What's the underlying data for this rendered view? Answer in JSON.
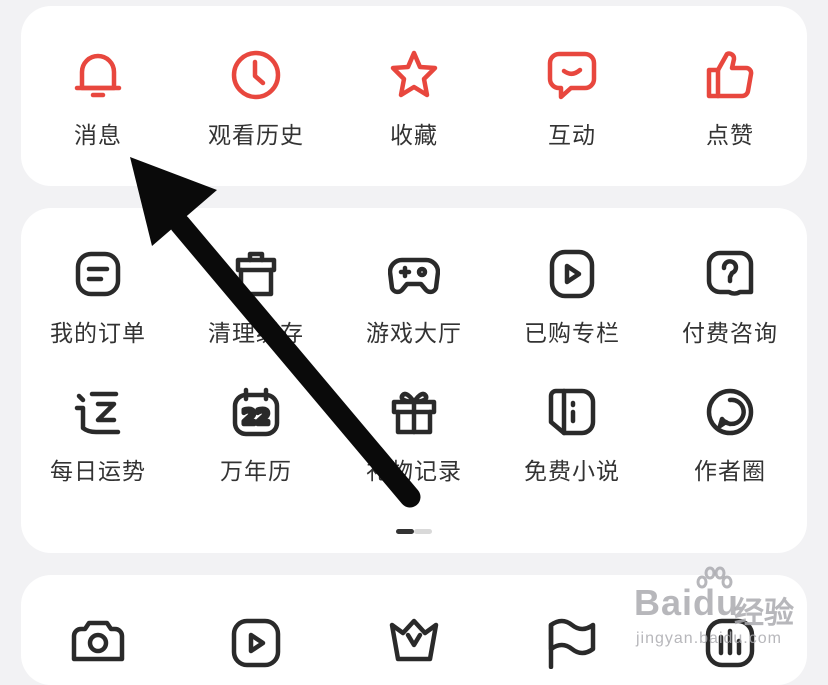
{
  "top_row": [
    {
      "label": "消息",
      "icon": "bell-icon"
    },
    {
      "label": "观看历史",
      "icon": "clock-icon"
    },
    {
      "label": "收藏",
      "icon": "star-icon"
    },
    {
      "label": "互动",
      "icon": "chat-bubble-icon"
    },
    {
      "label": "点赞",
      "icon": "thumbs-up-icon"
    }
  ],
  "tools_row1": [
    {
      "label": "我的订单",
      "icon": "order-icon"
    },
    {
      "label": "清理缓存",
      "icon": "broom-icon"
    },
    {
      "label": "游戏大厅",
      "icon": "gamepad-icon"
    },
    {
      "label": "已购专栏",
      "icon": "play-square-icon"
    },
    {
      "label": "付费咨询",
      "icon": "question-bubble-icon"
    }
  ],
  "tools_row2": [
    {
      "label": "每日运势",
      "icon": "fortune-icon"
    },
    {
      "label": "万年历",
      "icon": "calendar-icon"
    },
    {
      "label": "礼物记录",
      "icon": "gift-icon"
    },
    {
      "label": "免费小说",
      "icon": "book-icon"
    },
    {
      "label": "作者圈",
      "icon": "author-circle-icon"
    }
  ],
  "bottom_row_icons": [
    "camera-icon",
    "video-play-icon",
    "crown-icon",
    "flag-icon",
    "stats-icon"
  ],
  "pager": {
    "pages": 2,
    "active": 1
  },
  "colors": {
    "accent": "#e8473e",
    "icon_dark": "#2a2a2a",
    "text": "#333333",
    "card": "#ffffff",
    "background": "#f2f2f4"
  },
  "watermark": {
    "brand": "Baidu",
    "brand_cn": "经验",
    "url": "jingyan.baidu.com"
  }
}
